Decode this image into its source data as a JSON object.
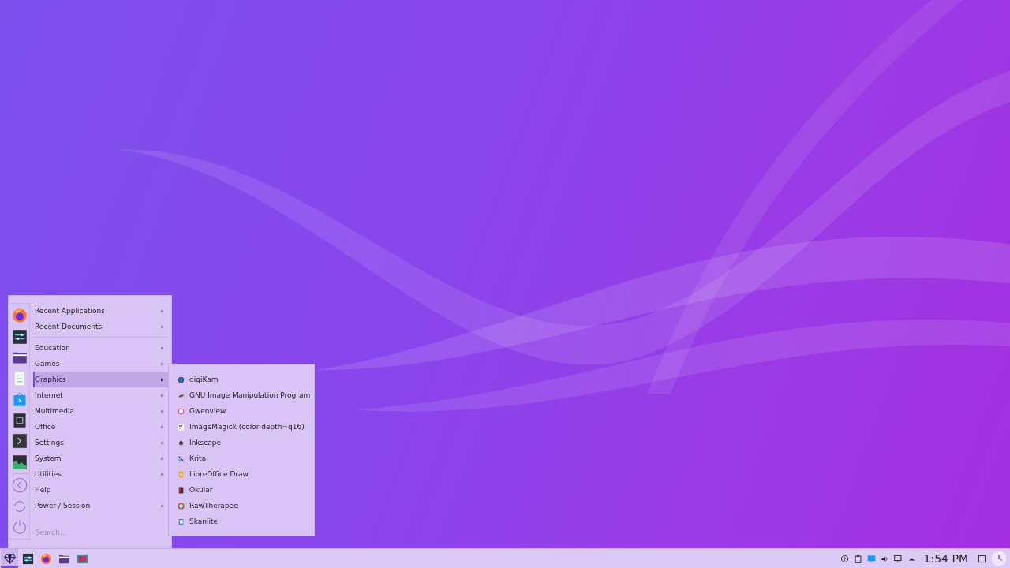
{
  "menu": {
    "sections": [
      [
        {
          "label": "Recent Applications",
          "has_submenu": true,
          "selected": false
        },
        {
          "label": "Recent Documents",
          "has_submenu": true,
          "selected": false
        }
      ],
      [
        {
          "label": "Education",
          "has_submenu": true,
          "selected": false
        },
        {
          "label": "Games",
          "has_submenu": true,
          "selected": false
        },
        {
          "label": "Graphics",
          "has_submenu": true,
          "selected": true
        },
        {
          "label": "Internet",
          "has_submenu": true,
          "selected": false
        },
        {
          "label": "Multimedia",
          "has_submenu": true,
          "selected": false
        },
        {
          "label": "Office",
          "has_submenu": true,
          "selected": false
        },
        {
          "label": "Settings",
          "has_submenu": true,
          "selected": false
        },
        {
          "label": "System",
          "has_submenu": true,
          "selected": false
        },
        {
          "label": "Utilities",
          "has_submenu": true,
          "selected": false
        },
        {
          "label": "Help",
          "has_submenu": false,
          "selected": false
        },
        {
          "label": "Power / Session",
          "has_submenu": true,
          "selected": false
        }
      ]
    ],
    "search": {
      "placeholder": "Search..."
    }
  },
  "submenu": {
    "items": [
      {
        "label": "digiKam"
      },
      {
        "label": "GNU Image Manipulation Program"
      },
      {
        "label": "Gwenview"
      },
      {
        "label": "ImageMagick (color depth=q16)"
      },
      {
        "label": "Inkscape"
      },
      {
        "label": "Krita"
      },
      {
        "label": "LibreOffice Draw"
      },
      {
        "label": "Okular"
      },
      {
        "label": "RawTherapee"
      },
      {
        "label": "Skanlite"
      }
    ]
  },
  "taskbar": {
    "launcher_active": true,
    "clock": "1:54 PM"
  }
}
